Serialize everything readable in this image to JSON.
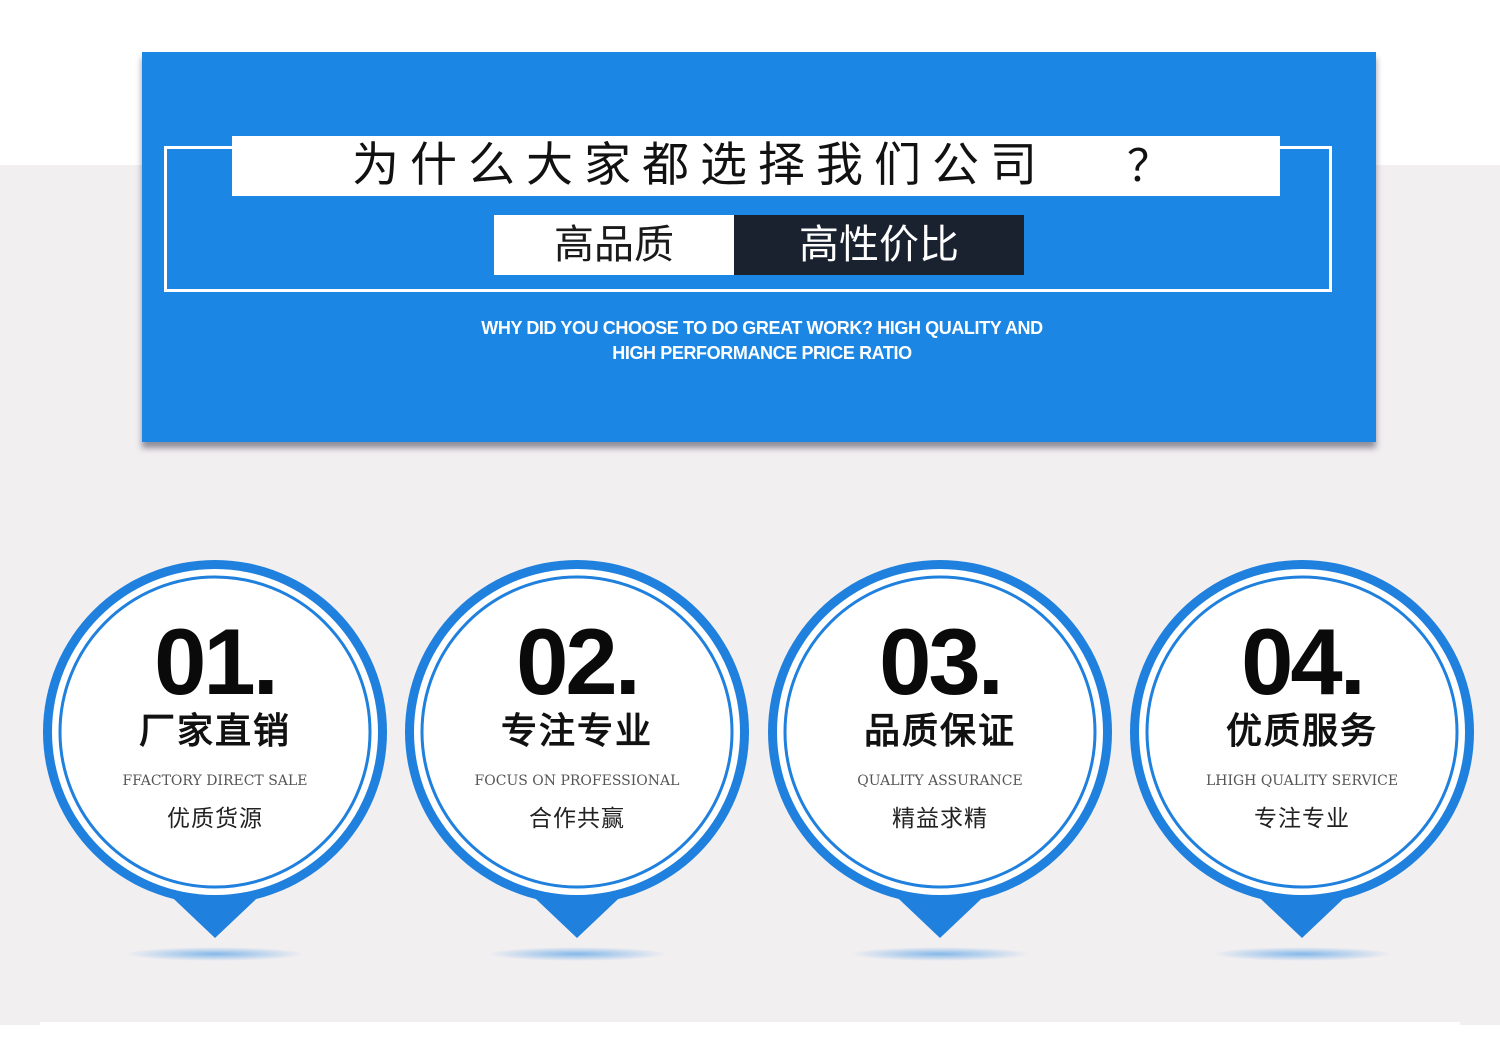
{
  "banner": {
    "title": "为什么大家都选择我们公司",
    "title_mark": "？",
    "tag_quality": "高品质",
    "tag_price": "高性价比",
    "subtitle_line1": "WHY DID YOU CHOOSE TO DO GREAT WORK? HIGH QUALITY AND",
    "subtitle_line2": "HIGH PERFORMANCE PRICE RATIO"
  },
  "features": [
    {
      "number": "01.",
      "title": "厂家直销",
      "english": "FFACTORY DIRECT SALE",
      "caption": "优质货源"
    },
    {
      "number": "02.",
      "title": "专注专业",
      "english": "FOCUS ON PROFESSIONAL",
      "caption": "合作共赢"
    },
    {
      "number": "03.",
      "title": "品质保证",
      "english": "QUALITY ASSURANCE",
      "caption": "精益求精"
    },
    {
      "number": "04.",
      "title": "优质服务",
      "english": "LHIGH QUALITY SERVICE",
      "caption": "专注专业"
    }
  ],
  "colors": {
    "brand_blue": "#1b86e4",
    "dark_tag": "#1a2230",
    "page_background": "#f2eff1"
  }
}
